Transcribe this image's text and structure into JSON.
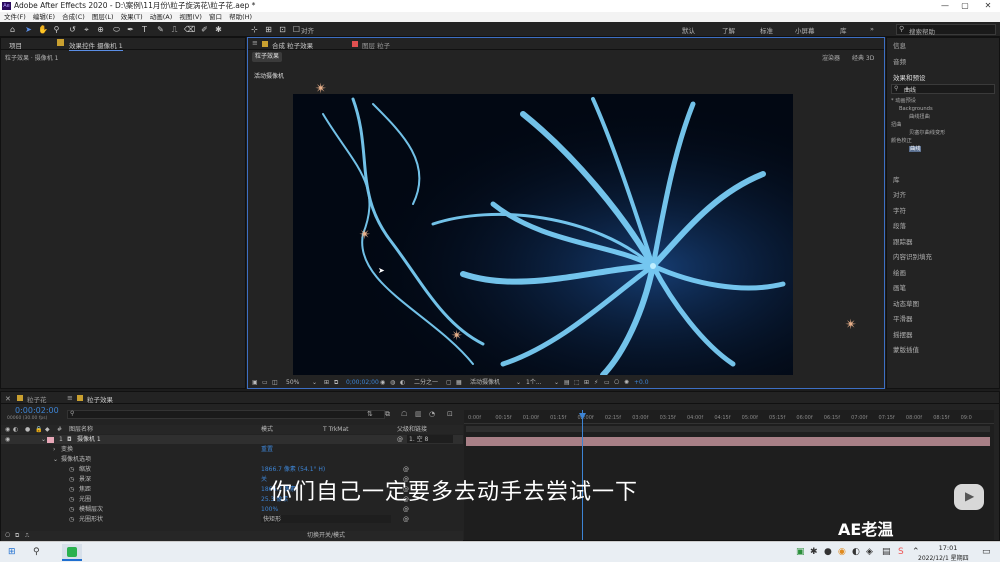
{
  "window": {
    "title": "Adobe After Effects 2020 - D:\\案例\\11月份\\粒子旋涡花\\粒子花.aep *"
  },
  "menu": [
    "文件(F)",
    "编辑(E)",
    "合成(C)",
    "图层(L)",
    "效果(T)",
    "动画(A)",
    "视图(V)",
    "窗口",
    "帮助(H)"
  ],
  "toolbar": {
    "align_label": "对齐",
    "workspaces": [
      "默认",
      "了解",
      "标准",
      "小屏幕",
      "库"
    ],
    "search_placeholder": "搜索帮助"
  },
  "project_panel": {
    "tab_project": "项目",
    "tab_effects": "效果控件 摄像机 1",
    "breadcrumb": "粒子效果 · 摄像机 1"
  },
  "comp_panel": {
    "tab_comp": "合成 粒子效果",
    "tab_layer": "图层 粒子",
    "comp_label": "粒子效果",
    "renderer_label": "渲染器",
    "renderer_value": "经典 3D",
    "camera_label": "活动摄像机",
    "footer": {
      "zoom": "50%",
      "time": "0;00;02;00",
      "resolution": "二分之一",
      "camera": "活动摄像机",
      "views": "1个...",
      "exposure": "+0.0"
    }
  },
  "right_panel": {
    "info": "信息",
    "audio": "音频",
    "effects_presets": "效果和预设",
    "search_value": "曲线",
    "tree": [
      "* 动画预设",
      "Backgrounds",
      "曲线扭曲",
      "扭曲",
      "贝塞尔曲线变形",
      "颜色校正",
      "曲线"
    ],
    "sections": [
      "库",
      "对齐",
      "字符",
      "段落",
      "跟踪器",
      "内容识别填充",
      "绘画",
      "画笔",
      "动态草图",
      "平滑器",
      "摇摆器",
      "蒙版插值"
    ]
  },
  "timeline": {
    "tab_1": "粒子花",
    "tab_2": "粒子效果",
    "timecode": "0:00:02:00",
    "timecode_sub": "00060 (30.00 fps)",
    "col_source": "图层名称",
    "col_mode": "模式",
    "col_trkmat": "T  TrkMat",
    "col_parent": "父级和链接",
    "layer_num": "1",
    "layer_name": "摄像机 1",
    "parent_value": "1. 空 8",
    "props": [
      {
        "name": "变换",
        "value": "重置"
      },
      {
        "name": "摄像机选项",
        "value": ""
      },
      {
        "name": "缩放",
        "value": "1866.7 像素 (54.1° H)"
      },
      {
        "name": "景深",
        "value": "关"
      },
      {
        "name": "焦距",
        "value": "1866.7 像素"
      },
      {
        "name": "光圈",
        "value": "25.3 像素"
      },
      {
        "name": "模糊层次",
        "value": "100%"
      },
      {
        "name": "光圈形状",
        "value": "快矩形"
      }
    ],
    "ruler": [
      "0:00f",
      "00:15f",
      "01:00f",
      "01:15f",
      "02:00f",
      "02:15f",
      "03:00f",
      "03:15f",
      "04:00f",
      "04:15f",
      "05:00f",
      "05:15f",
      "06:00f",
      "06:15f",
      "07:00f",
      "07:15f",
      "08:00f",
      "08:15f",
      "09:0"
    ],
    "switch_label": "切换开关/模式"
  },
  "overlay": {
    "subtitle": "你们自己一定要多去动手去尝试一下",
    "watermark": "AE老温"
  },
  "taskbar": {
    "time": "17:01",
    "date": "2022/12/1 星期四"
  }
}
